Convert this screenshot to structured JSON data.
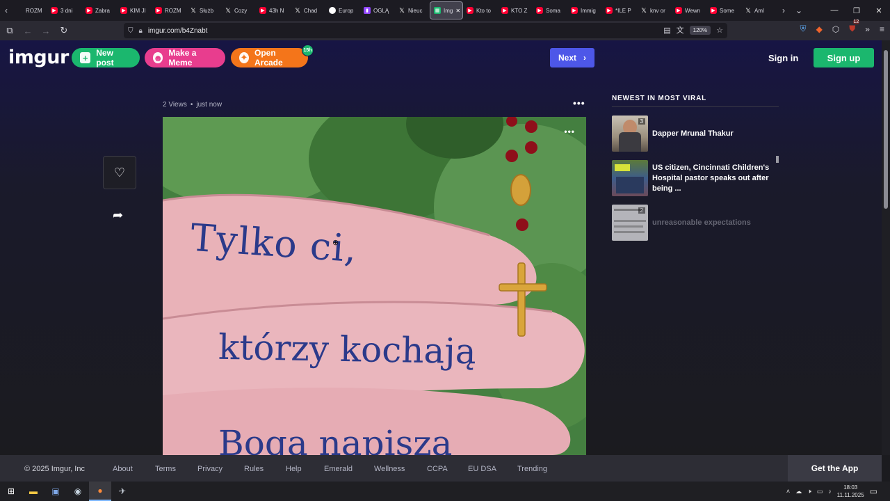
{
  "browser": {
    "tabs": [
      {
        "label": "ROZM",
        "icon": "favicon"
      },
      {
        "label": "3 dni",
        "icon": "youtube"
      },
      {
        "label": "Zabra",
        "icon": "youtube"
      },
      {
        "label": "KIM JI",
        "icon": "youtube"
      },
      {
        "label": "ROZM",
        "icon": "youtube"
      },
      {
        "label": "Służb",
        "icon": "x"
      },
      {
        "label": "Cozy",
        "icon": "x"
      },
      {
        "label": "43h N",
        "icon": "youtube"
      },
      {
        "label": "Chad",
        "icon": "x"
      },
      {
        "label": "Europ",
        "icon": "eu"
      },
      {
        "label": "OGLĄ",
        "icon": "twitch"
      },
      {
        "label": "Nieuc",
        "icon": "x"
      },
      {
        "label": "Img",
        "icon": "imgur",
        "active": true
      },
      {
        "label": "Kto to",
        "icon": "youtube"
      },
      {
        "label": "KTO Z",
        "icon": "youtube"
      },
      {
        "label": "Soma",
        "icon": "youtube"
      },
      {
        "label": "Immig",
        "icon": "youtube"
      },
      {
        "label": "*ILE P",
        "icon": "youtube"
      },
      {
        "label": "knv or",
        "icon": "x"
      },
      {
        "label": "Wewn",
        "icon": "youtube"
      },
      {
        "label": "Some",
        "icon": "youtube"
      },
      {
        "label": "Aml",
        "icon": "x"
      }
    ],
    "url": "imgur.com/b4Znabt",
    "zoom": "120%",
    "extension_badge": "12"
  },
  "header": {
    "logo": "imgur",
    "new_post": "New post",
    "make_meme": "Make a Meme",
    "open_arcade": "Open Arcade",
    "arcade_badge": "15h",
    "next": "Next",
    "sign_in": "Sign in",
    "sign_up": "Sign up"
  },
  "post": {
    "views": "2 Views",
    "separator": "•",
    "time": "just now",
    "image_text": [
      "Tylko ci,",
      "którzy kochają",
      "Boga napiszą"
    ]
  },
  "sidebar": {
    "title": "NEWEST IN MOST VIRAL",
    "items": [
      {
        "title": "Dapper Mrunal Thakur",
        "count": "3"
      },
      {
        "title": "US citizen, Cincinnati Children's Hospital pastor speaks out after being ...",
        "count": ""
      },
      {
        "title": "unreasonable expectations",
        "count": "2"
      }
    ]
  },
  "footer": {
    "copyright": "© 2025 Imgur, Inc",
    "links": [
      "About",
      "Terms",
      "Privacy",
      "Rules",
      "Help",
      "Emerald",
      "Wellness",
      "CCPA",
      "EU DSA",
      "Trending"
    ],
    "get_app": "Get the App"
  },
  "taskbar": {
    "time": "18:03",
    "date": "11.11.2025"
  },
  "colors": {
    "green": "#1bb76e",
    "pink": "#e83d8e",
    "orange": "#f4751a",
    "next_blue": "#4d57e8"
  }
}
